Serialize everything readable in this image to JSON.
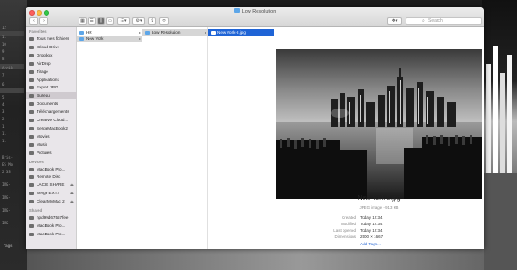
{
  "desktop": {
    "left_marks": [
      "12",
      "11",
      "10",
      "9",
      "8",
      "7",
      "6",
      "5",
      "4",
      "3",
      "2",
      "1",
      "11",
      "11"
    ],
    "left_labels": [
      "Arriè",
      "Bris-",
      "ES Mo",
      "2.3S",
      "IMG-",
      "IMG-",
      "IMG-",
      "IMG-"
    ]
  },
  "window": {
    "title": "Low Resolution",
    "toolbar": {
      "view_icons": [
        "icon-view",
        "list-view",
        "column-view",
        "cover-flow-view"
      ],
      "arrange": "arrange",
      "action": "action",
      "share": "share",
      "tags": "tags",
      "dropbox": "dropbox",
      "search_placeholder": "Search"
    },
    "sidebar": {
      "favorites_header": "Favorites",
      "favorites": [
        {
          "label": "Tous mes fichiers",
          "icon": "all-files-icon"
        },
        {
          "label": "iCloud Drive",
          "icon": "icloud-icon"
        },
        {
          "label": "Dropbox",
          "icon": "dropbox-icon"
        },
        {
          "label": "AirDrop",
          "icon": "airdrop-icon"
        },
        {
          "label": "Tirage",
          "icon": "folder-icon"
        },
        {
          "label": "Applications",
          "icon": "applications-icon"
        },
        {
          "label": "Export JPG",
          "icon": "folder-icon"
        },
        {
          "label": "Bureau",
          "icon": "desktop-icon"
        },
        {
          "label": "Documents",
          "icon": "documents-icon"
        },
        {
          "label": "Téléchargements",
          "icon": "downloads-icon"
        },
        {
          "label": "Creative Cloud...",
          "icon": "creative-cloud-icon"
        },
        {
          "label": "SergeMacBook2",
          "icon": "home-icon"
        },
        {
          "label": "Movies",
          "icon": "movies-icon"
        },
        {
          "label": "Music",
          "icon": "music-icon"
        },
        {
          "label": "Pictures",
          "icon": "pictures-icon"
        }
      ],
      "selected_favorite": "Bureau",
      "devices_header": "Devices",
      "devices": [
        {
          "label": "MacBook Pro...",
          "icon": "laptop-icon",
          "eject": false
        },
        {
          "label": "Remote Disc",
          "icon": "disc-icon",
          "eject": false
        },
        {
          "label": "LACIE SHARE",
          "icon": "drive-icon",
          "eject": true
        },
        {
          "label": "Serge EXT2",
          "icon": "drive-icon",
          "eject": true
        },
        {
          "label": "CleanMyMac 2",
          "icon": "drive-icon",
          "eject": true
        }
      ],
      "shared_header": "Shared",
      "shared": [
        {
          "label": "hpd99d67557fee",
          "icon": "network-icon"
        },
        {
          "label": "MacBook Pro...",
          "icon": "laptop-icon"
        },
        {
          "label": "MacBook Pro...",
          "icon": "laptop-icon"
        }
      ],
      "tags_header": "Tags"
    },
    "columns": {
      "col1": [
        {
          "label": "HR",
          "selected": false
        },
        {
          "label": "New York",
          "selected": true
        }
      ],
      "col2": [
        {
          "label": "Low Resolution",
          "selected": true
        }
      ],
      "col3": [
        {
          "label": "New York-8.jpg",
          "selected": true
        }
      ]
    },
    "preview": {
      "file_name": "New York-8.jpg",
      "kind": "JPEG image - 913 KB",
      "meta": [
        {
          "key": "Created",
          "value": "Today 12:34"
        },
        {
          "key": "Modified",
          "value": "Today 12:34"
        },
        {
          "key": "Last opened",
          "value": "Today 12:34"
        },
        {
          "key": "Dimensions",
          "value": "2500 × 1667"
        }
      ],
      "add_tags": "Add Tags..."
    }
  }
}
